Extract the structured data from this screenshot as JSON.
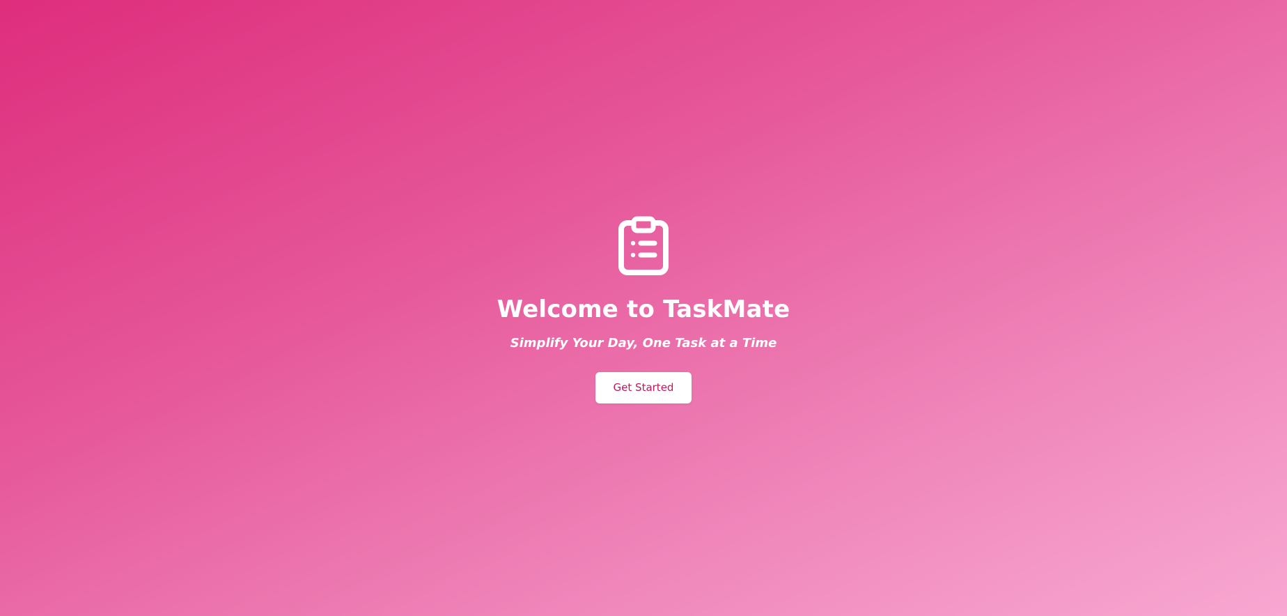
{
  "hero": {
    "icon": "clipboard-list-icon",
    "title": "Welcome to TaskMate",
    "tagline": "Simplify Your Day, One Task at a Time",
    "cta_label": "Get Started"
  },
  "colors": {
    "gradient_start": "#de2d7c",
    "gradient_end": "#f8a8d2",
    "button_background": "#ffffff",
    "button_text": "#c2185b",
    "text": "#ffffff"
  }
}
